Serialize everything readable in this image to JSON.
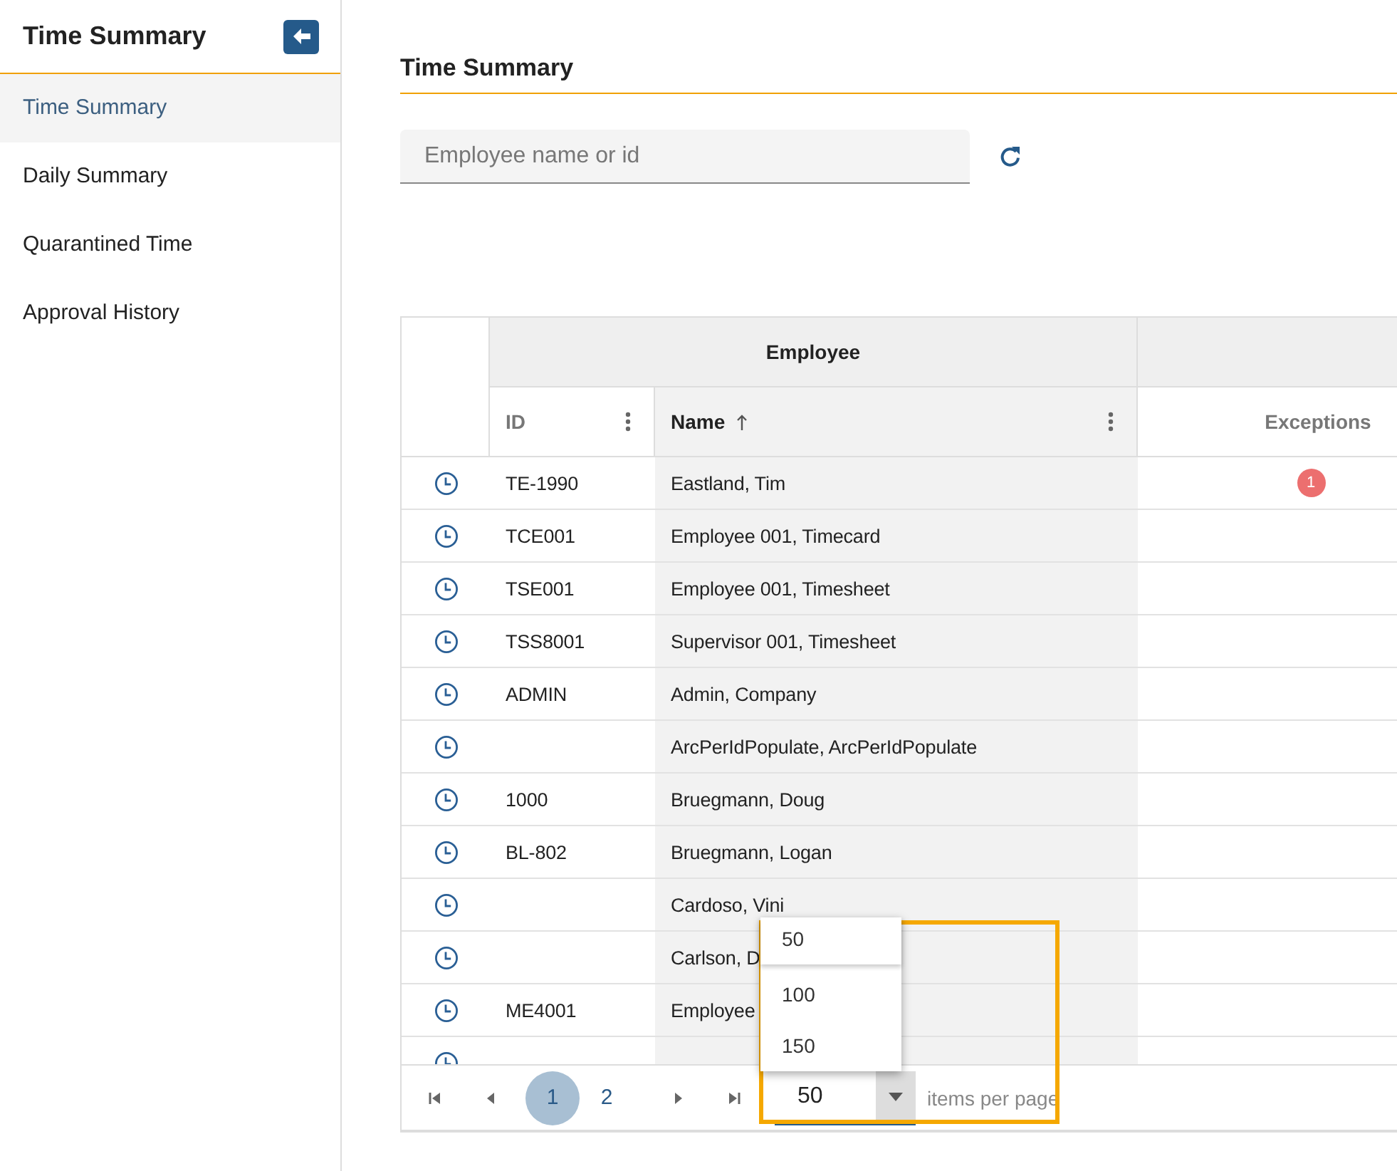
{
  "sidebar": {
    "title": "Time Summary",
    "items": [
      {
        "label": "Time Summary",
        "selected": true
      },
      {
        "label": "Daily Summary",
        "selected": false
      },
      {
        "label": "Quarantined Time",
        "selected": false
      },
      {
        "label": "Approval History",
        "selected": false
      }
    ]
  },
  "page": {
    "title": "Time Summary"
  },
  "search": {
    "placeholder": "Employee name or id"
  },
  "table": {
    "group_header": "Employee",
    "columns": [
      {
        "label": "ID",
        "menu": true,
        "sorted": false
      },
      {
        "label": "Name",
        "menu": true,
        "sorted": true
      },
      {
        "label": "Exceptions",
        "menu": false,
        "sorted": false
      }
    ],
    "rows": [
      {
        "id": "TE-1990",
        "name": "Eastland, Tim",
        "exceptions": "1"
      },
      {
        "id": "TCE001",
        "name": "Employee 001, Timecard"
      },
      {
        "id": "TSE001",
        "name": "Employee 001, Timesheet"
      },
      {
        "id": "TSS8001",
        "name": "Supervisor 001, Timesheet"
      },
      {
        "id": "ADMIN",
        "name": "Admin, Company"
      },
      {
        "name": "ArcPerIdPopulate, ArcPerIdPopulate"
      },
      {
        "id": "1000",
        "name": "Bruegmann, Doug"
      },
      {
        "id": "BL-802",
        "name": "Bruegmann, Logan"
      },
      {
        "name": "Cardoso, Vini"
      },
      {
        "name": "Carlson, D"
      },
      {
        "id": "ME4001",
        "name": "Employee"
      },
      {}
    ]
  },
  "pager": {
    "pages": [
      {
        "label": "1",
        "selected": true
      },
      {
        "label": "2",
        "selected": false
      }
    ],
    "page_size": "50",
    "page_size_label": "items per page",
    "dropdown": {
      "open": true,
      "options": [
        {
          "label": "50",
          "selected": true
        },
        {
          "label": "100",
          "selected": false
        },
        {
          "label": "150",
          "selected": false
        }
      ]
    }
  }
}
